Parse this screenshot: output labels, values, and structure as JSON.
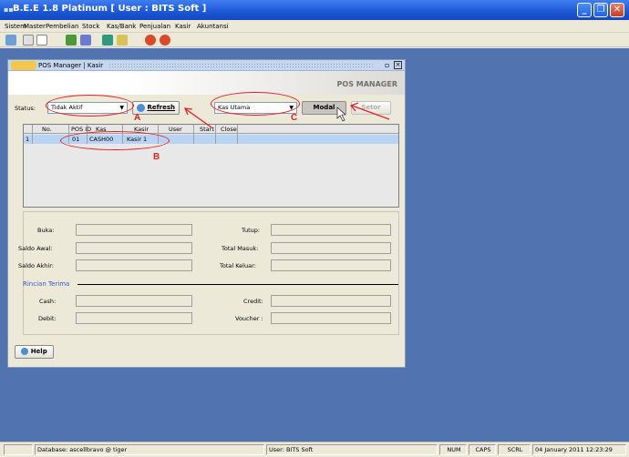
{
  "window": {
    "title": "B.E.E 1.8 Platinum [ User : BITS Soft ]"
  },
  "menu": [
    "Sistem",
    "Master",
    "Pembelian",
    "Stock",
    "Kas/Bank",
    "Penjualan",
    "Kasir",
    "Akuntansi"
  ],
  "toolbar_icons": [
    "note-icon",
    "flag-icon",
    "page-icon",
    "users-icon",
    "calculator-icon",
    "tree-icon",
    "folder-icon",
    "stop-icon",
    "power-icon"
  ],
  "pos": {
    "window_title": "POS Manager | Kasir",
    "header_title": "POS MANAGER",
    "status_label": "Status:",
    "status_value": "Tidak Aktif",
    "refresh_label": "Refresh",
    "kas_value": "Kas Utama",
    "modal_label": "Modal",
    "setor_label": "Setor",
    "grid_headers": [
      "No.",
      "POS ID",
      "Kas",
      "Kasir",
      "User",
      "Start",
      "Close"
    ],
    "grid_rows": [
      {
        "row": "1",
        "pos_id": "01",
        "kas": "CASH00",
        "kasir": "Kasir 1",
        "user": "",
        "start": "",
        "close": ""
      }
    ],
    "fields": {
      "buka": "Buka:",
      "tutup": "Tutup:",
      "saldo_awal": "Saldo Awal:",
      "total_masuk": "Total Masuk:",
      "saldo_akhir": "Saldo Akhir:",
      "total_keluar": "Total Keluar:",
      "rincian": "Rincian Terima",
      "cash": "Cash:",
      "credit": "Credit:",
      "debit": "Debit:",
      "voucher": "Voucher :"
    },
    "help_label": "Help"
  },
  "annotations": {
    "a": "A",
    "b": "B",
    "c": "C"
  },
  "statusbar": {
    "database": "Database: ascellbravo @ tiger",
    "user": "User: BITS Soft",
    "num": "NUM",
    "caps": "CAPS",
    "scrl": "SCRL",
    "datetime": "04 January 2011  12:23:29"
  },
  "colors": {
    "desktop": "#5174b0",
    "titlebar": "#1a56d6",
    "annotation": "#e62020",
    "row_selected": "#b9d3f5"
  }
}
